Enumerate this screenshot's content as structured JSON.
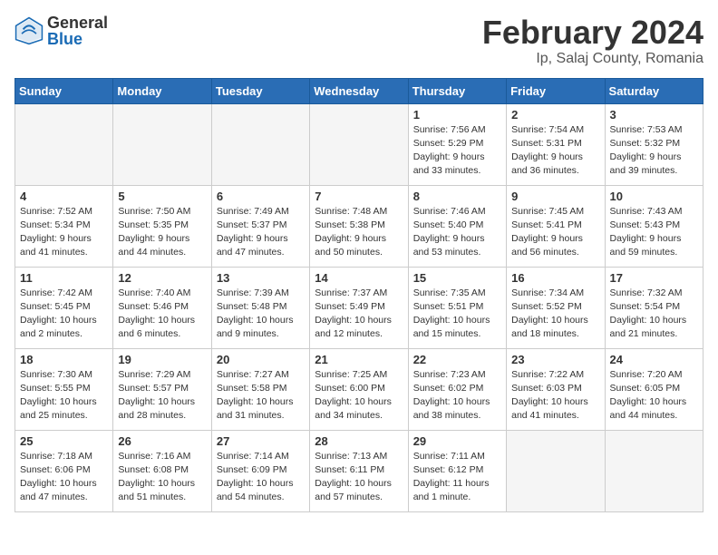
{
  "header": {
    "logo_general": "General",
    "logo_blue": "Blue",
    "month": "February 2024",
    "location": "Ip, Salaj County, Romania"
  },
  "days_of_week": [
    "Sunday",
    "Monday",
    "Tuesday",
    "Wednesday",
    "Thursday",
    "Friday",
    "Saturday"
  ],
  "weeks": [
    [
      {
        "day": "",
        "info": ""
      },
      {
        "day": "",
        "info": ""
      },
      {
        "day": "",
        "info": ""
      },
      {
        "day": "",
        "info": ""
      },
      {
        "day": "1",
        "info": "Sunrise: 7:56 AM\nSunset: 5:29 PM\nDaylight: 9 hours\nand 33 minutes."
      },
      {
        "day": "2",
        "info": "Sunrise: 7:54 AM\nSunset: 5:31 PM\nDaylight: 9 hours\nand 36 minutes."
      },
      {
        "day": "3",
        "info": "Sunrise: 7:53 AM\nSunset: 5:32 PM\nDaylight: 9 hours\nand 39 minutes."
      }
    ],
    [
      {
        "day": "4",
        "info": "Sunrise: 7:52 AM\nSunset: 5:34 PM\nDaylight: 9 hours\nand 41 minutes."
      },
      {
        "day": "5",
        "info": "Sunrise: 7:50 AM\nSunset: 5:35 PM\nDaylight: 9 hours\nand 44 minutes."
      },
      {
        "day": "6",
        "info": "Sunrise: 7:49 AM\nSunset: 5:37 PM\nDaylight: 9 hours\nand 47 minutes."
      },
      {
        "day": "7",
        "info": "Sunrise: 7:48 AM\nSunset: 5:38 PM\nDaylight: 9 hours\nand 50 minutes."
      },
      {
        "day": "8",
        "info": "Sunrise: 7:46 AM\nSunset: 5:40 PM\nDaylight: 9 hours\nand 53 minutes."
      },
      {
        "day": "9",
        "info": "Sunrise: 7:45 AM\nSunset: 5:41 PM\nDaylight: 9 hours\nand 56 minutes."
      },
      {
        "day": "10",
        "info": "Sunrise: 7:43 AM\nSunset: 5:43 PM\nDaylight: 9 hours\nand 59 minutes."
      }
    ],
    [
      {
        "day": "11",
        "info": "Sunrise: 7:42 AM\nSunset: 5:45 PM\nDaylight: 10 hours\nand 2 minutes."
      },
      {
        "day": "12",
        "info": "Sunrise: 7:40 AM\nSunset: 5:46 PM\nDaylight: 10 hours\nand 6 minutes."
      },
      {
        "day": "13",
        "info": "Sunrise: 7:39 AM\nSunset: 5:48 PM\nDaylight: 10 hours\nand 9 minutes."
      },
      {
        "day": "14",
        "info": "Sunrise: 7:37 AM\nSunset: 5:49 PM\nDaylight: 10 hours\nand 12 minutes."
      },
      {
        "day": "15",
        "info": "Sunrise: 7:35 AM\nSunset: 5:51 PM\nDaylight: 10 hours\nand 15 minutes."
      },
      {
        "day": "16",
        "info": "Sunrise: 7:34 AM\nSunset: 5:52 PM\nDaylight: 10 hours\nand 18 minutes."
      },
      {
        "day": "17",
        "info": "Sunrise: 7:32 AM\nSunset: 5:54 PM\nDaylight: 10 hours\nand 21 minutes."
      }
    ],
    [
      {
        "day": "18",
        "info": "Sunrise: 7:30 AM\nSunset: 5:55 PM\nDaylight: 10 hours\nand 25 minutes."
      },
      {
        "day": "19",
        "info": "Sunrise: 7:29 AM\nSunset: 5:57 PM\nDaylight: 10 hours\nand 28 minutes."
      },
      {
        "day": "20",
        "info": "Sunrise: 7:27 AM\nSunset: 5:58 PM\nDaylight: 10 hours\nand 31 minutes."
      },
      {
        "day": "21",
        "info": "Sunrise: 7:25 AM\nSunset: 6:00 PM\nDaylight: 10 hours\nand 34 minutes."
      },
      {
        "day": "22",
        "info": "Sunrise: 7:23 AM\nSunset: 6:02 PM\nDaylight: 10 hours\nand 38 minutes."
      },
      {
        "day": "23",
        "info": "Sunrise: 7:22 AM\nSunset: 6:03 PM\nDaylight: 10 hours\nand 41 minutes."
      },
      {
        "day": "24",
        "info": "Sunrise: 7:20 AM\nSunset: 6:05 PM\nDaylight: 10 hours\nand 44 minutes."
      }
    ],
    [
      {
        "day": "25",
        "info": "Sunrise: 7:18 AM\nSunset: 6:06 PM\nDaylight: 10 hours\nand 47 minutes."
      },
      {
        "day": "26",
        "info": "Sunrise: 7:16 AM\nSunset: 6:08 PM\nDaylight: 10 hours\nand 51 minutes."
      },
      {
        "day": "27",
        "info": "Sunrise: 7:14 AM\nSunset: 6:09 PM\nDaylight: 10 hours\nand 54 minutes."
      },
      {
        "day": "28",
        "info": "Sunrise: 7:13 AM\nSunset: 6:11 PM\nDaylight: 10 hours\nand 57 minutes."
      },
      {
        "day": "29",
        "info": "Sunrise: 7:11 AM\nSunset: 6:12 PM\nDaylight: 11 hours\nand 1 minute."
      },
      {
        "day": "",
        "info": ""
      },
      {
        "day": "",
        "info": ""
      }
    ]
  ]
}
